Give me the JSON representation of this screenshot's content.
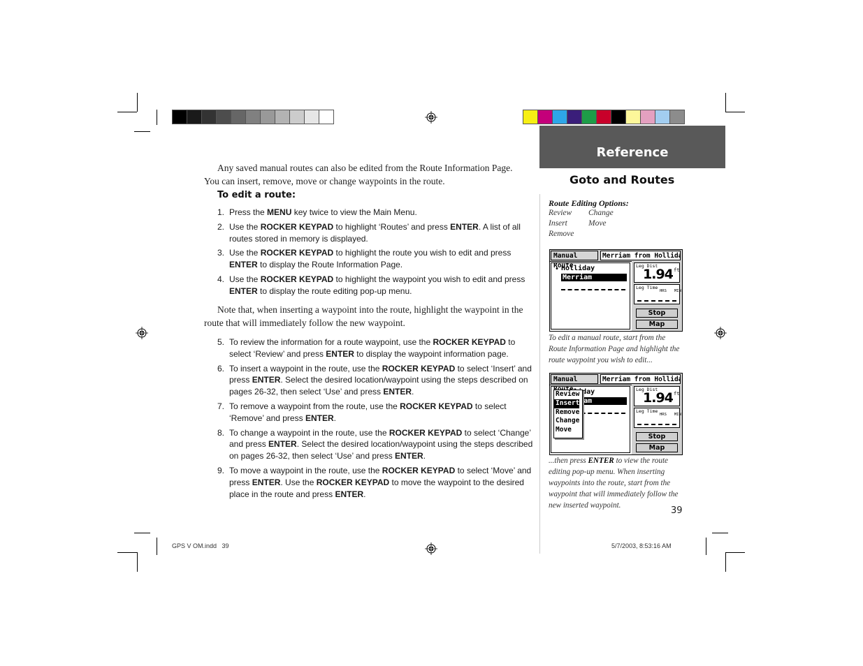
{
  "header": {
    "section": "Reference",
    "title": "Goto and Routes"
  },
  "colors": {
    "header_bg": "#595959",
    "grayscale_bar": [
      "#000000",
      "#1a1a1a",
      "#333333",
      "#4d4d4d",
      "#666666",
      "#808080",
      "#999999",
      "#b3b3b3",
      "#cccccc",
      "#e6e6e6",
      "#ffffff"
    ],
    "color_bar": [
      "#f7ef14",
      "#c4007a",
      "#2ea6e8",
      "#3a1e7a",
      "#1e9c48",
      "#c8002a",
      "#000000",
      "#fdf79a",
      "#e4a0c0",
      "#a2cdf0",
      "#8c8c8c"
    ]
  },
  "main": {
    "intro": "Any saved manual routes can also be edited from the Route Information Page.  You can insert, remove, move or change waypoints in the route.",
    "subhead": "To edit a route:",
    "steps_a": [
      {
        "num": "1.",
        "html": "Press the <b>MENU</b> key twice to view the Main Menu."
      },
      {
        "num": "2.",
        "html": "Use the <b>ROCKER KEYPAD</b> to highlight ‘Routes’ and press <b>ENTER</b>. A list of all routes stored in memory is displayed."
      },
      {
        "num": "3.",
        "html": "Use the <b>ROCKER KEYPAD</b> to highlight the route you wish to edit and press <b>ENTER</b> to display the Route Information Page."
      },
      {
        "num": "4.",
        "html": "Use the <b>ROCKER KEYPAD</b> to highlight the waypoint you wish to edit and press <b>ENTER</b> to display the route editing pop-up menu."
      }
    ],
    "note": "Note that, when inserting a waypoint into the route, highlight the waypoint in the route that will immediately follow the new waypoint.",
    "steps_b": [
      {
        "num": "5.",
        "html": "To review the information for a route waypoint, use the <b>ROCKER KEYPAD</b> to select ‘Review’  and press <b>ENTER</b> to display the waypoint information page."
      },
      {
        "num": "6.",
        "html": "To insert a waypoint in the route, use the <b>ROCKER KEYPAD</b> to select ‘Insert’ and press <b>ENTER</b>. Select the desired location/waypoint using the steps described on pages 26-32, then select ‘Use’ and press <b>ENTER</b>."
      },
      {
        "num": "7.",
        "html": "To remove a waypoint from the route, use the <b>ROCKER KEYPAD</b> to select ‘Remove’ and press <b>ENTER</b>."
      },
      {
        "num": "8.",
        "html": "To change a waypoint in the route, use the <b>ROCKER KEYPAD</b> to select ‘Change’ and press <b>ENTER</b>. Select the desired location/waypoint using the steps described on pages 26-32, then select ‘Use’ and press <b>ENTER</b>."
      },
      {
        "num": "9.",
        "html": "To move a waypoint in the route, use the <b>ROCKER KEYPAD</b> to select ‘Move’ and press <b>ENTER</b>. Use the <b>ROCKER KEYPAD</b> to move the waypoint to the desired place in the route and press <b>ENTER</b>."
      }
    ]
  },
  "sidebar": {
    "options_title": "Route Editing Options:",
    "options": [
      "Review",
      "Change",
      "Insert",
      "Move",
      "Remove"
    ],
    "caption1": "To edit a manual route, start from the Route Information Page and highlight the route waypoint you wish to edit...",
    "caption2_pre": "...then press ",
    "caption2_key": "ENTER",
    "caption2_post": " to view the route editing pop-up menu. When inserting waypoints into the route, start from the waypoint that will immediately follow the new inserted waypoint."
  },
  "gps_screen": {
    "tab_left": "Manual Route",
    "tab_right": "Merriam from Holliday",
    "waypoints": [
      "Holliday",
      "Merriam"
    ],
    "leg_dist_label": "Leg Dist",
    "leg_dist_value": "1.94",
    "leg_dist_unit": "ft",
    "leg_time_label": "Leg Time",
    "hrs_label": "HRS",
    "min_label": "MIN",
    "stop_button": "Stop",
    "map_button": "Map",
    "popup_items": [
      "Review",
      "Insert",
      "Remove",
      "Change",
      "Move"
    ],
    "popup_selected": "Insert"
  },
  "footer": {
    "file": "GPS V OM.indd   39",
    "timestamp": "5/7/2003, 8:53:16 AM",
    "page_number": "39"
  }
}
